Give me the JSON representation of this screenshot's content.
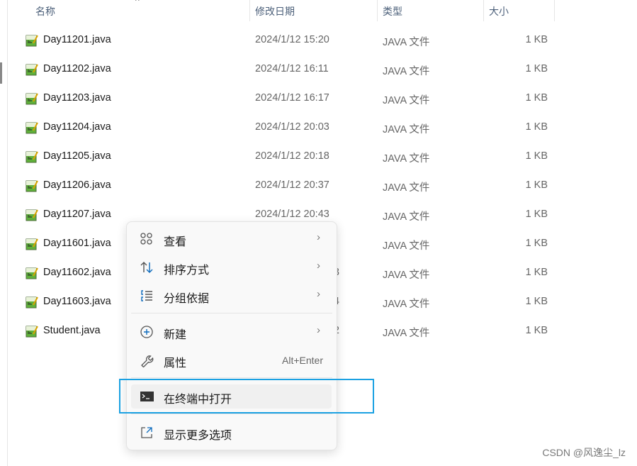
{
  "header": {
    "name": "名称",
    "date": "修改日期",
    "type": "类型",
    "size": "大小",
    "sort_indicator": "^"
  },
  "files": [
    {
      "name": "Day11201.java",
      "date": "2024/1/12 15:20",
      "type": "JAVA 文件",
      "size": "1 KB"
    },
    {
      "name": "Day11202.java",
      "date": "2024/1/12 16:11",
      "type": "JAVA 文件",
      "size": "1 KB"
    },
    {
      "name": "Day11203.java",
      "date": "2024/1/12 16:17",
      "type": "JAVA 文件",
      "size": "1 KB"
    },
    {
      "name": "Day11204.java",
      "date": "2024/1/12 20:03",
      "type": "JAVA 文件",
      "size": "1 KB"
    },
    {
      "name": "Day11205.java",
      "date": "2024/1/12 20:18",
      "type": "JAVA 文件",
      "size": "1 KB"
    },
    {
      "name": "Day11206.java",
      "date": "2024/1/12 20:37",
      "type": "JAVA 文件",
      "size": "1 KB"
    },
    {
      "name": "Day11207.java",
      "date": "2024/1/12 20:43",
      "type": "JAVA 文件",
      "size": "1 KB"
    },
    {
      "name": "Day11601.java",
      "date": "",
      "type": "JAVA 文件",
      "size": "1 KB"
    },
    {
      "name": "Day11602.java",
      "date": "3",
      "type": "JAVA 文件",
      "size": "1 KB"
    },
    {
      "name": "Day11603.java",
      "date": "4",
      "type": "JAVA 文件",
      "size": "1 KB"
    },
    {
      "name": "Student.java",
      "date": "2",
      "type": "JAVA 文件",
      "size": "1 KB"
    }
  ],
  "menu": {
    "view": "查看",
    "sort": "排序方式",
    "group": "分组依据",
    "new": "新建",
    "properties": "属性",
    "properties_shortcut": "Alt+Enter",
    "terminal": "在终端中打开",
    "more": "显示更多选项",
    "arrow": "›"
  },
  "watermark": "CSDN @风逸尘_lz",
  "colors": {
    "highlight_box": "#1ba1e2",
    "accent": "#0f6cbd"
  }
}
